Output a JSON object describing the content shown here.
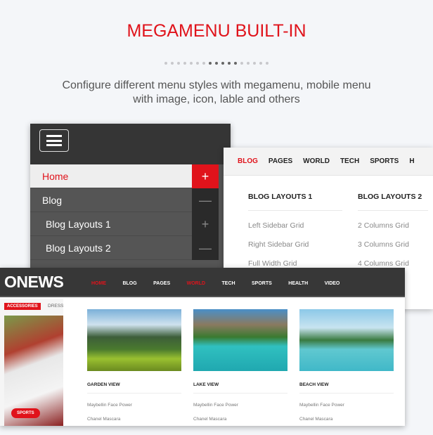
{
  "heading": "MEGAMENU BUILT-IN",
  "dots": {
    "count": 17,
    "active": [
      7,
      8,
      9,
      10,
      11
    ]
  },
  "subtitle": [
    "Configure different menu styles with megamenu, mobile menu",
    "with image, icon, lable and others"
  ],
  "mobile_menu": {
    "items": [
      {
        "label": "Home",
        "toggle": "+",
        "active": true
      },
      {
        "label": "Blog",
        "toggle": "—"
      },
      {
        "label": "Blog Layouts 1",
        "toggle": "+"
      },
      {
        "label": "Blog Layouts 2",
        "toggle": "—"
      }
    ]
  },
  "megamenu": {
    "nav": [
      "BLOG",
      "PAGES",
      "WORLD",
      "TECH",
      "SPORTS",
      "H"
    ],
    "columns": [
      {
        "title": "BLOG LAYOUTS 1",
        "links": [
          "Left Sidebar Grid",
          "Right Sidebar Grid",
          "Full Width Grid"
        ]
      },
      {
        "title": "BLOG LAYOUTS 2",
        "links": [
          "2 Columns Grid",
          "3 Columns Grid",
          "4 Columns Grid"
        ]
      }
    ]
  },
  "onews": {
    "logo": "ONEWS",
    "nav": [
      "HOME",
      "BLOG",
      "PAGES",
      "WORLD",
      "TECH",
      "SPORTS",
      "HEALTH",
      "VIDEO"
    ],
    "sidebar": {
      "tag": "ACCESSORIES",
      "tab": "DRESS",
      "badge": "SPORTS"
    },
    "cards": [
      {
        "title": "GARDEN VIEW",
        "links": [
          "Maybellin Face Power",
          "Chanel Mascara"
        ]
      },
      {
        "title": "LAKE VIEW",
        "links": [
          "Maybellin Face Power",
          "Chanel Mascara"
        ]
      },
      {
        "title": "BEACH VIEW",
        "links": [
          "Maybellin Face Power",
          "Chanel Mascara"
        ]
      }
    ]
  },
  "colors": {
    "accent": "#e0131b",
    "dark": "#373737"
  }
}
